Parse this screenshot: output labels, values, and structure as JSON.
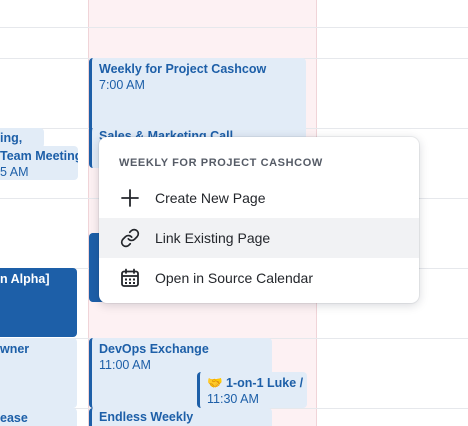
{
  "calendar": {
    "left_column_events": [
      {
        "title": "ing,",
        "subtitle": ""
      },
      {
        "title": "Team Meeting",
        "subtitle": "5 AM"
      },
      {
        "title": "n Alpha]",
        "subtitle": ""
      },
      {
        "title": "wner",
        "subtitle": ""
      },
      {
        "title": "ease",
        "subtitle": ""
      }
    ],
    "today_events": [
      {
        "title": "Weekly for Project Cashcow",
        "subtitle": "7:00 AM"
      },
      {
        "title": "Sales & Marketing Call",
        "subtitle": ""
      },
      {
        "title": "DevOps Exchange",
        "subtitle": "11:00 AM"
      },
      {
        "title": "🤝 1-on-1 Luke /",
        "subtitle": "11:30 AM"
      },
      {
        "title": "Endless Weekly",
        "subtitle": ""
      }
    ]
  },
  "context_menu": {
    "header": "WEEKLY FOR PROJECT CASHCOW",
    "items": [
      {
        "label": "Create New Page",
        "icon": "plus-icon"
      },
      {
        "label": "Link Existing Page",
        "icon": "link-icon"
      },
      {
        "label": "Open in Source Calendar",
        "icon": "calendar-icon"
      }
    ]
  },
  "colors": {
    "event_accent": "#1d5fa8",
    "event_background": "#e2ecf7",
    "today_column": "#fdf1f3"
  }
}
